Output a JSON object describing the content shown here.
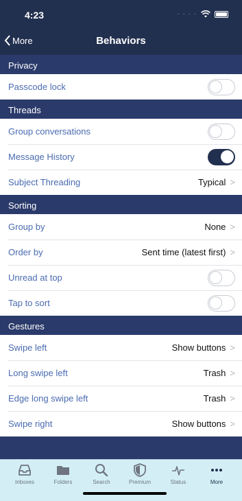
{
  "status_bar": {
    "time": "4:23"
  },
  "navbar": {
    "back_label": "More",
    "title": "Behaviors"
  },
  "sections": {
    "privacy": {
      "header": "Privacy",
      "passcode_lock": {
        "label": "Passcode lock",
        "on": false
      }
    },
    "threads": {
      "header": "Threads",
      "group_conversations": {
        "label": "Group conversations",
        "on": false
      },
      "message_history": {
        "label": "Message History",
        "on": true
      },
      "subject_threading": {
        "label": "Subject Threading",
        "value": "Typical"
      }
    },
    "sorting": {
      "header": "Sorting",
      "group_by": {
        "label": "Group by",
        "value": "None"
      },
      "order_by": {
        "label": "Order by",
        "value": "Sent time (latest first)"
      },
      "unread_at_top": {
        "label": "Unread at top",
        "on": false
      },
      "tap_to_sort": {
        "label": "Tap to sort",
        "on": false
      }
    },
    "gestures": {
      "header": "Gestures",
      "swipe_left": {
        "label": "Swipe left",
        "value": "Show buttons"
      },
      "long_swipe_left": {
        "label": "Long swipe left",
        "value": "Trash"
      },
      "edge_long_swipe_left": {
        "label": "Edge long swipe left",
        "value": "Trash"
      },
      "swipe_right": {
        "label": "Swipe right",
        "value": "Show buttons"
      }
    }
  },
  "tabbar": {
    "inboxes": "Inboxes",
    "folders": "Folders",
    "search": "Search",
    "premium": "Premium",
    "status": "Status",
    "more": "More",
    "active_tab": "More"
  },
  "colors": {
    "nav_background": "#22304f",
    "section_background": "#2a3a6a",
    "label_text": "#4a6bb0",
    "tabbar_background": "#d3eff5",
    "toggle_on": "#22304f"
  }
}
